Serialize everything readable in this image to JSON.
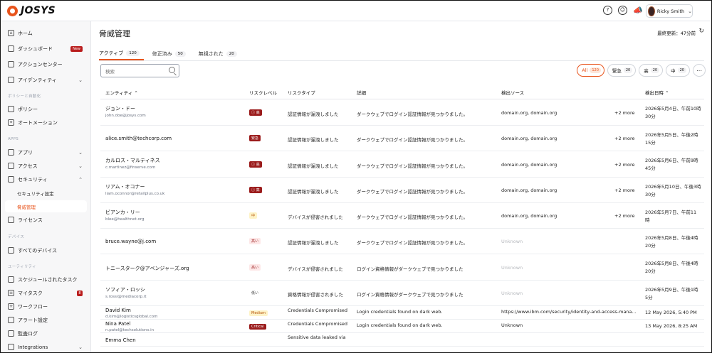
{
  "brand": {
    "name": "JOSYS"
  },
  "topbar": {
    "icons": [
      "help-icon",
      "smile-icon",
      "megaphone-icon"
    ],
    "user_name": "Ricky Smith"
  },
  "sidebar": {
    "items": [
      {
        "label": "ホーム",
        "icon": "home-icon"
      },
      {
        "label": "ダッシュボード",
        "icon": "dashboard-icon",
        "badge": "New"
      },
      {
        "label": "アクションセンター",
        "icon": "action-icon"
      },
      {
        "label": "アイデンティティ",
        "icon": "identity-icon"
      },
      {
        "label": "ポリシー",
        "icon": "policy-icon"
      },
      {
        "label": "オートメーション",
        "icon": "automation-icon"
      },
      {
        "label": "アプリ",
        "icon": "apps-icon"
      },
      {
        "label": "アクセス",
        "icon": "access-icon"
      },
      {
        "label": "セキュリティ",
        "icon": "shield-icon"
      },
      {
        "label": "セキュリティ設定"
      },
      {
        "label": "脅威管理"
      },
      {
        "label": "ライセンス",
        "icon": "license-icon"
      },
      {
        "label": "すべてのデバイス",
        "icon": "device-icon"
      },
      {
        "label": "スケジュールされたタスク",
        "icon": "calendar-icon"
      },
      {
        "label": "マイタスク",
        "icon": "tasks-icon",
        "badge": "8"
      },
      {
        "label": "ワークフロー",
        "icon": "workflow-icon"
      },
      {
        "label": "アラート設定",
        "icon": "bell-icon"
      },
      {
        "label": "監査ログ",
        "icon": "log-icon"
      },
      {
        "label": "Integrations",
        "icon": "integrations-icon"
      }
    ],
    "sections": [
      "ポリシーと自動化",
      "APPS",
      "デバイス",
      "ユーティリティ"
    ]
  },
  "main": {
    "title": "脅威管理",
    "last_updated": "最終更新：47分前",
    "tabs": [
      {
        "label": "アクティブ",
        "count": "120"
      },
      {
        "label": "修正済み",
        "count": "50"
      },
      {
        "label": "無視された",
        "count": "20"
      }
    ],
    "search_placeholder": "検索",
    "filters": [
      {
        "label": "All",
        "count": "120"
      },
      {
        "label": "緊急",
        "count": "20"
      },
      {
        "label": "高",
        "count": "20"
      },
      {
        "label": "中",
        "count": "20"
      }
    ],
    "columns": [
      "エンティティ",
      "リスクレベル",
      "リスクタイプ",
      "詳細",
      "検出ソース",
      "検出日時"
    ],
    "rows": [
      {
        "name": "ジョン・ドー",
        "email": "john.doe@josys.com",
        "risk": "高",
        "risk_style": "dark",
        "risk_icon": true,
        "type": "認証情報が漏洩しました",
        "detail": "ダークウェブでログイン認証情報が見つかりました。",
        "source": "domain.org, domain.org",
        "more": "+2 more",
        "date1": "2026年5月4日、午前10時",
        "date2": "30分"
      },
      {
        "name": "alice.smith@techcorp.com",
        "email": "",
        "risk": "緊急",
        "risk_style": "dark",
        "risk_icon": false,
        "type": "認証情報が漏洩しました",
        "detail": "ダークウェブでログイン認証情報が見つかりました。",
        "source": "domain.org, domain.org",
        "more": "+2 more",
        "date1": "2026年5月5日、午後2時",
        "date2": "15分"
      },
      {
        "name": "カルロス・マルティネス",
        "email": "c.martinez@finserve.com",
        "risk": "高",
        "risk_style": "dark",
        "risk_icon": true,
        "type": "認証情報が漏洩しました",
        "detail": "ダークウェブでログイン認証情報が見つかりました。",
        "source": "domain.org, domain.org",
        "more": "+2 more",
        "date1": "2026年5月6日、午前9時",
        "date2": "45分"
      },
      {
        "name": "リアム・オコナー",
        "email": "liam.oconnor@retailplus.co.uk",
        "risk": "高",
        "risk_style": "dark",
        "risk_icon": true,
        "type": "認証情報が漏洩しました",
        "detail": "ダークウェブでログイン認証情報が見つかりました。",
        "source": "domain.org, domain.org",
        "more": "+2 more",
        "date1": "2026年5月10日、午後3時",
        "date2": "30分"
      },
      {
        "name": "ビアンカ・リー",
        "email": "blee@healthnet.org",
        "risk": "中",
        "risk_style": "yellow",
        "risk_icon": false,
        "type": "デバイスが侵害されました",
        "detail": "ダークウェブでログイン認証情報が見つかりました。",
        "source": "domain.org, domain.org",
        "more": "+2 more",
        "date1": "2026年5月7日、午前11",
        "date2": "時"
      },
      {
        "name": "bruce.wayne@j.com",
        "email": "",
        "risk": "高い",
        "risk_style": "light",
        "risk_icon": false,
        "type": "認証情報が漏洩しました",
        "detail": "ダークウェブでログイン認証情報が見つかりました。",
        "source": "Unknown",
        "more": "",
        "date1": "2026年5月8日、午後4時",
        "date2": "20分"
      },
      {
        "name": "トニースターク@アベンジャーズ.org",
        "email": "",
        "risk": "高い",
        "risk_style": "light",
        "risk_icon": false,
        "type": "デバイスが侵害されました",
        "detail": "ログイン資格情報がダークウェブで見つかりました",
        "source": "Unknown",
        "more": "",
        "date1": "2026年5月8日、午後4時",
        "date2": "20分"
      },
      {
        "name": "ソフィア・ロッシ",
        "email": "s.rossi@mediacorp.it",
        "risk": "低い",
        "risk_style": "plain",
        "risk_icon": false,
        "type": "資格情報が侵害されました",
        "detail": "ログイン資格情報がダークウェブで見つかりました",
        "source": "Unknown",
        "more": "",
        "date1": "2026年5月9日、午後1時",
        "date2": "5分"
      },
      {
        "name": "David Kim",
        "email": "d.kim@logisticsglobal.com",
        "risk": "Medium",
        "risk_style": "yellow",
        "risk_icon": false,
        "type": "Credentials Compromised",
        "detail": "Login credentials found on dark web.",
        "source": "https://www.ibm.com/security/identity-and-access-mana...",
        "more": "",
        "date1": "12 May 2026, 5:40 PM",
        "date2": ""
      },
      {
        "name": "Nina Patel",
        "email": "n.patel@techsolutions.in",
        "risk": "Critical",
        "risk_style": "dark",
        "risk_icon": false,
        "type": "Credentials Compromised",
        "detail": "Login credentials found on dark web.",
        "source": "Unknown",
        "more": "",
        "date1": "13 May 2026, 8:25 AM",
        "date2": ""
      },
      {
        "name": "Emma Chen",
        "email": "",
        "risk": "",
        "risk_style": "plain",
        "risk_icon": false,
        "type": "Sensitive data leaked via",
        "detail": "",
        "source": "",
        "more": "",
        "date1": "",
        "date2": ""
      }
    ]
  },
  "colors": {
    "accent": "#e8541c",
    "critical": "#9b1c1c"
  }
}
